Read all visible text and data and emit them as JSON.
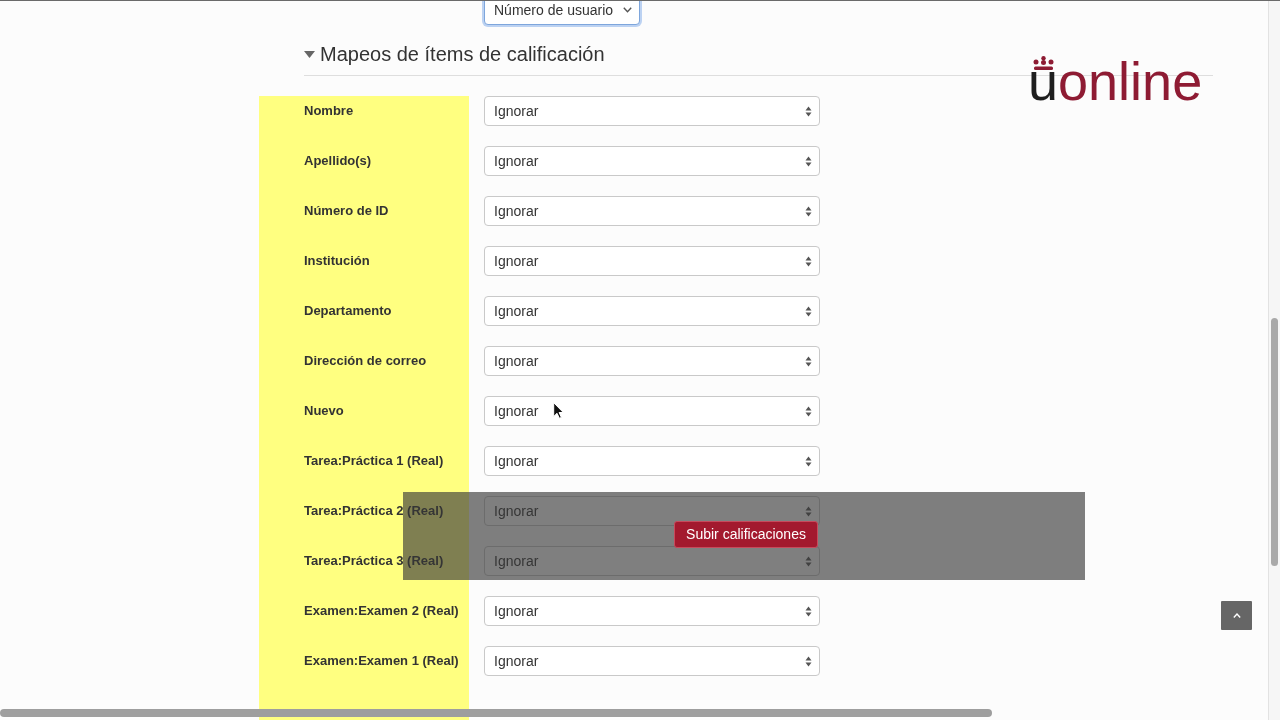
{
  "top_mapping": {
    "value": "Número de usuario",
    "focused": true
  },
  "section": {
    "title": "Mapeos de ítems de calificación",
    "expanded": true
  },
  "logo": {
    "mark": "u",
    "text": "online"
  },
  "mappings": [
    {
      "label": "Nombre",
      "value": "Ignorar"
    },
    {
      "label": "Apellido(s)",
      "value": "Ignorar"
    },
    {
      "label": "Número de ID",
      "value": "Ignorar"
    },
    {
      "label": "Institución",
      "value": "Ignorar"
    },
    {
      "label": "Departamento",
      "value": "Ignorar"
    },
    {
      "label": "Dirección de correo",
      "value": "Ignorar"
    },
    {
      "label": "Nuevo",
      "value": "Ignorar"
    },
    {
      "label": "Tarea:Práctica 1 (Real)",
      "value": "Ignorar"
    },
    {
      "label": "Tarea:Práctica 2 (Real)",
      "value": "Ignorar"
    },
    {
      "label": "Tarea:Práctica 3 (Real)",
      "value": "Ignorar"
    },
    {
      "label": "Examen:Examen 2 (Real)",
      "value": "Ignorar"
    },
    {
      "label": "Examen:Examen 1 (Real)",
      "value": "Ignorar"
    }
  ],
  "submit_bar": {
    "button": "Subir calificaciones"
  }
}
